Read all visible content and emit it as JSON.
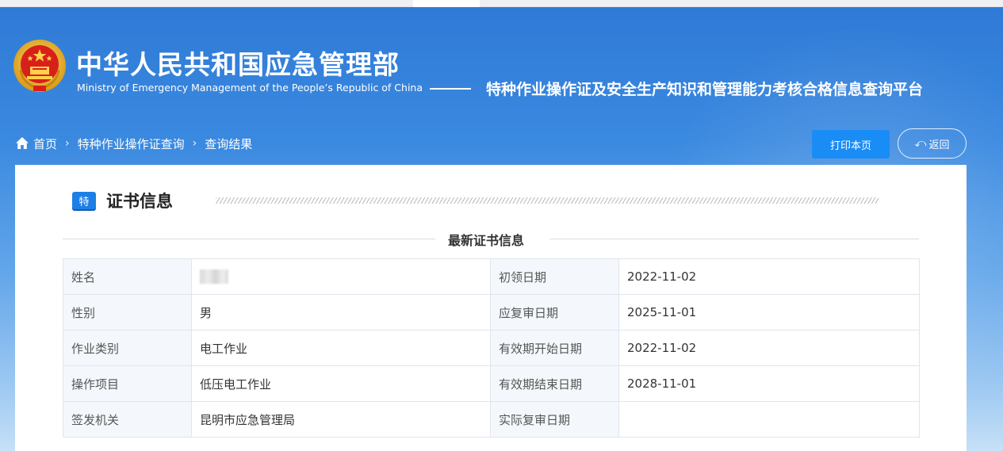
{
  "header": {
    "title_cn": "中华人民共和国应急管理部",
    "title_en": "Ministry of Emergency Management of the People’s Republic of China",
    "platform": "特种作业操作证及安全生产知识和管理能力考核合格信息查询平台",
    "emblem_icon": "national-emblem-icon"
  },
  "breadcrumb": {
    "home": "首页",
    "items": [
      "特种作业操作证查询",
      "查询结果"
    ]
  },
  "actions": {
    "print_label": "打印本页",
    "back_label": "返回"
  },
  "section": {
    "badge": "特",
    "title": "证书信息",
    "subtitle": "最新证书信息"
  },
  "table": {
    "rows": [
      {
        "label1": "姓名",
        "value1": "",
        "label2": "初领日期",
        "value2": "2022-11-02"
      },
      {
        "label1": "性别",
        "value1": "男",
        "label2": "应复审日期",
        "value2": "2025-11-01"
      },
      {
        "label1": "作业类别",
        "value1": "电工作业",
        "label2": "有效期开始日期",
        "value2": "2022-11-02"
      },
      {
        "label1": "操作项目",
        "value1": "低压电工作业",
        "label2": "有效期结束日期",
        "value2": "2028-11-01"
      },
      {
        "label1": "签发机关",
        "value1": "昆明市应急管理局",
        "label2": "实际复审日期",
        "value2": ""
      }
    ]
  },
  "colors": {
    "header_blue": "#2f7ad6",
    "button_blue": "#1a8cf5",
    "badge_blue": "#1d7fe6"
  }
}
